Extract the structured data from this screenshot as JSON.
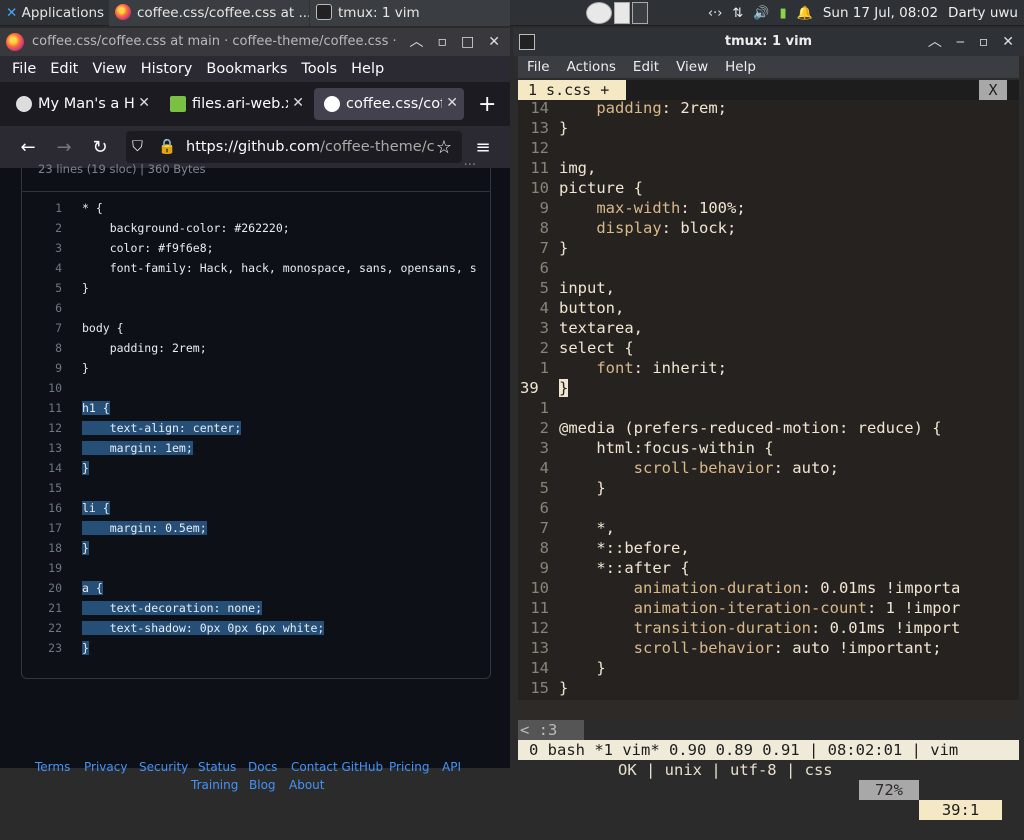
{
  "panel": {
    "apps_label": "Applications",
    "task1": "coffee.css/coffee.css at ...",
    "task2": "tmux: 1 vim",
    "datetime": "Sun 17 Jul, 08:02",
    "user": "Darty uwu"
  },
  "browser": {
    "title": "coffee.css/coffee.css at main · coffee-theme/coffee.css ·",
    "menu": [
      "File",
      "Edit",
      "View",
      "History",
      "Bookmarks",
      "Tools",
      "Help"
    ],
    "tabs": [
      "My Man's a He",
      "files.ari-web.x",
      "coffee.css/coff"
    ],
    "url_main": "https://github.com",
    "url_rest": "/coffee-theme/c",
    "fileinfo": "23 lines (19 sloc)  |  360 Bytes",
    "code": [
      {
        "n": "1",
        "t": "* {"
      },
      {
        "n": "2",
        "t": "    background-color: #262220;"
      },
      {
        "n": "3",
        "t": "    color: #f9f6e8;"
      },
      {
        "n": "4",
        "t": "    font-family: Hack, hack, monospace, sans, opensans, s"
      },
      {
        "n": "5",
        "t": "}"
      },
      {
        "n": "6",
        "t": ""
      },
      {
        "n": "7",
        "t": "body {"
      },
      {
        "n": "8",
        "t": "    padding: 2rem;"
      },
      {
        "n": "9",
        "t": "}"
      },
      {
        "n": "10",
        "t": ""
      },
      {
        "n": "11",
        "t": "h1 {"
      },
      {
        "n": "12",
        "t": "    text-align: center;"
      },
      {
        "n": "13",
        "t": "    margin: 1em;"
      },
      {
        "n": "14",
        "t": "}"
      },
      {
        "n": "15",
        "t": ""
      },
      {
        "n": "16",
        "t": "li {"
      },
      {
        "n": "17",
        "t": "    margin: 0.5em;"
      },
      {
        "n": "18",
        "t": "}"
      },
      {
        "n": "19",
        "t": ""
      },
      {
        "n": "20",
        "t": "a {"
      },
      {
        "n": "21",
        "t": "    text-decoration: none;"
      },
      {
        "n": "22",
        "t": "    text-shadow: 0px 0px 6px white;"
      },
      {
        "n": "23",
        "t": "}"
      }
    ],
    "footer": [
      "Terms",
      "Privacy",
      "Security",
      "Status",
      "Docs",
      "Contact GitHub",
      "Pricing",
      "API",
      "Training",
      "Blog",
      "About"
    ]
  },
  "terminal": {
    "title": "tmux: 1 vim",
    "menu": [
      "File",
      "Actions",
      "Edit",
      "View",
      "Help"
    ],
    "vim_tab": "1 s.css +",
    "vim_tab_close": "X",
    "lines": [
      {
        "n": "14",
        "t": "    padding: 2rem;"
      },
      {
        "n": "13",
        "t": "}"
      },
      {
        "n": "12",
        "t": ""
      },
      {
        "n": "11",
        "t": "img,"
      },
      {
        "n": "10",
        "t": "picture {"
      },
      {
        "n": "9",
        "t": "    max-width: 100%;"
      },
      {
        "n": "8",
        "t": "    display: block;"
      },
      {
        "n": "7",
        "t": "}"
      },
      {
        "n": "6",
        "t": ""
      },
      {
        "n": "5",
        "t": "input,"
      },
      {
        "n": "4",
        "t": "button,"
      },
      {
        "n": "3",
        "t": "textarea,"
      },
      {
        "n": "2",
        "t": "select {"
      },
      {
        "n": "1",
        "t": "    font: inherit;"
      },
      {
        "n": "39",
        "t": "}"
      },
      {
        "n": "1",
        "t": ""
      },
      {
        "n": "2",
        "t": "@media (prefers-reduced-motion: reduce) {"
      },
      {
        "n": "3",
        "t": "    html:focus-within {"
      },
      {
        "n": "4",
        "t": "        scroll-behavior: auto;"
      },
      {
        "n": "5",
        "t": "    }"
      },
      {
        "n": "6",
        "t": ""
      },
      {
        "n": "7",
        "t": "    *,"
      },
      {
        "n": "8",
        "t": "    *::before,"
      },
      {
        "n": "9",
        "t": "    *::after {"
      },
      {
        "n": "10",
        "t": "        animation-duration: 0.01ms !importa"
      },
      {
        "n": "11",
        "t": "        animation-iteration-count: 1 !impor"
      },
      {
        "n": "12",
        "t": "        transition-duration: 0.01ms !import"
      },
      {
        "n": "13",
        "t": "        scroll-behavior: auto !important;"
      },
      {
        "n": "14",
        "t": "    }"
      },
      {
        "n": "15",
        "t": "}"
      }
    ],
    "status": {
      "left": "< :3",
      "plus": "+",
      "info": "OK | unix | utf-8 | css",
      "percent": "72%",
      "pos": "39:1"
    },
    "tmux_bar": "0 bash *1 vim* 0.90 0.89 0.91 | 08:02:01 | vim"
  }
}
